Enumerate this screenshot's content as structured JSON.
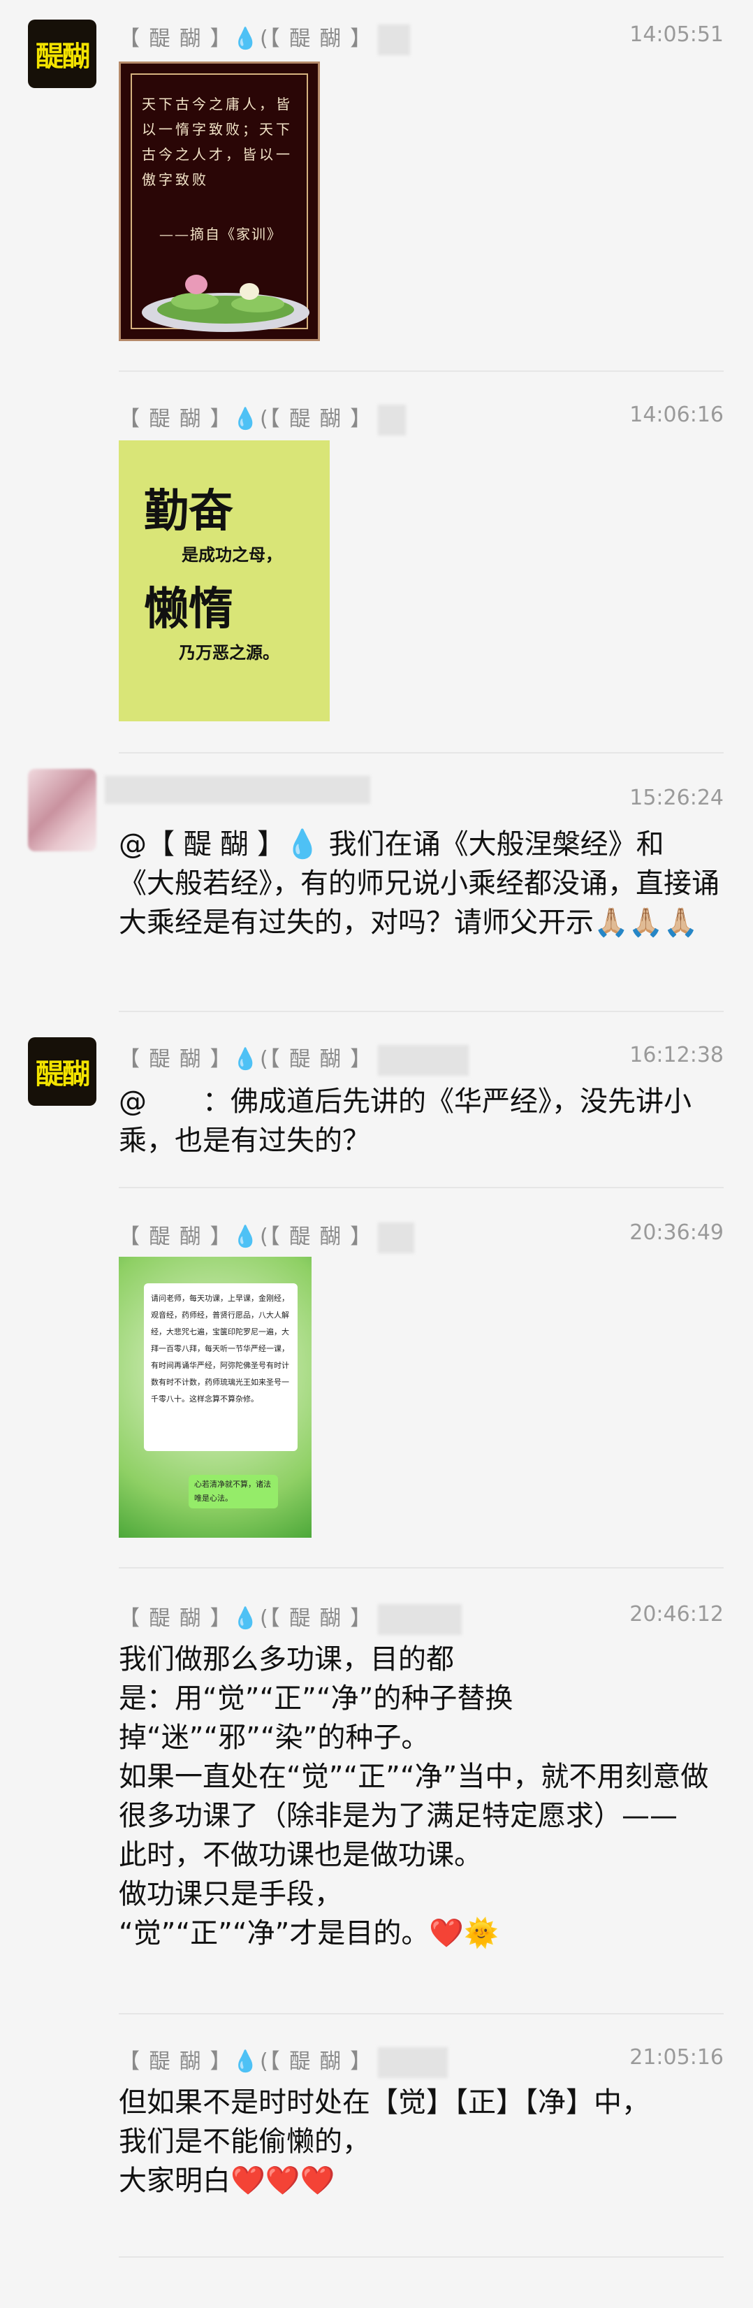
{
  "messages": [
    {
      "sender": "【 醍 醐 】",
      "drop": "💧",
      "sender_suffix": "(【 醍 醐 】",
      "time": "14:05:51",
      "image": {
        "text": "天下古今之庸人，皆以一惰字致败；天下古今之人才，皆以一傲字致败",
        "source": "——摘自《家训》"
      }
    },
    {
      "sender": "【 醍 醐 】",
      "drop": "💧",
      "sender_suffix": "(【 醍 醐 】",
      "time": "14:06:16",
      "image": {
        "big1": "勤奋",
        "small1": "是成功之母，",
        "big2": "懒惰",
        "small2": "乃万恶之源。"
      }
    },
    {
      "time": "15:26:24",
      "text": "@【 醍 醐 】💧 我们在诵《大般涅槃经》和《大般若经》，有的师兄说小乘经都没诵，直接诵大乘经是有过失的，对吗？请师父开示🙏🏼🙏🏼🙏🏼"
    },
    {
      "sender": "【 醍 醐 】",
      "drop": "💧",
      "sender_suffix": "(【 醍 醐 】",
      "time": "16:12:38",
      "text": "@　　：佛成道后先讲的《华严经》，没先讲小乘，也是有过失的？"
    },
    {
      "sender": "【 醍 醐 】",
      "drop": "💧",
      "sender_suffix": "(【 醍 醐 】",
      "time": "20:36:49",
      "image": {
        "card_text": "请问老师，每天功课，上早课，金刚经，观音经，药师经，普贤行愿品，八大人解经，大悲咒七遍，宝箧印陀罗尼一遍，大拜一百零八拜，每天听一节华严经一课，有时间再诵华严经，阿弥陀佛圣号有时计数有时不计数，药师琉璃光王如来圣号一千零八十。这样念算不算杂修。",
        "bubble_text": "心若清净就不算，诸法唯是心法。"
      }
    },
    {
      "sender": "【 醍 醐 】",
      "drop": "💧",
      "sender_suffix": "(【 醍 醐 】",
      "time": "20:46:12",
      "lines": [
        "我们做那么多功课，目的都",
        "是：用“觉”“正”“净”的种子替换",
        "掉“迷”“邪”“染”的种子。",
        "如果一直处在“觉”“正”“净”当中，就不用刻意做很多功课了（除非是为了满足特定愿求）——",
        "此时，不做功课也是做功课。",
        "做功课只是手段，",
        "“觉”“正”“净”才是目的。❤️🌞"
      ]
    },
    {
      "sender": "【 醍 醐 】",
      "drop": "💧",
      "sender_suffix": "(【 醍 醐 】",
      "time": "21:05:16",
      "lines": [
        "但如果不是时时处在【觉】【正】【净】中，",
        "我们是不能偷懒的，",
        "大家明白❤️❤️❤️"
      ]
    }
  ],
  "avatar": {
    "logo_text": "醍醐"
  }
}
